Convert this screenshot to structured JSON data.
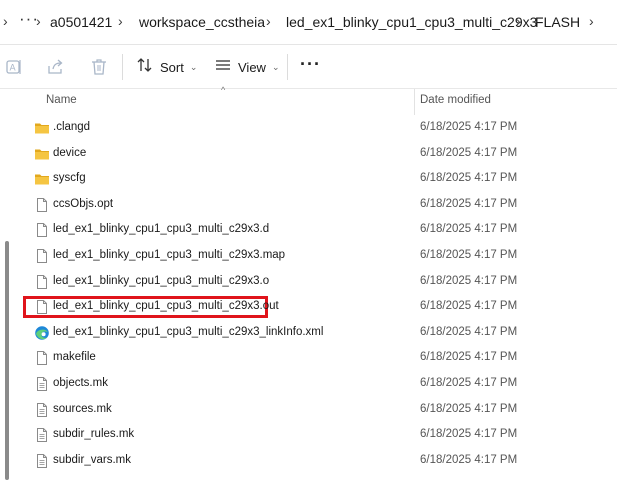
{
  "breadcrumb": {
    "more_label": "···",
    "items": [
      {
        "label": "a0501421"
      },
      {
        "label": "workspace_ccstheia"
      },
      {
        "label": "led_ex1_blinky_cpu1_cpu3_multi_c29x3"
      },
      {
        "label": "FLASH"
      }
    ]
  },
  "toolbar": {
    "sort_label": "Sort",
    "view_label": "View",
    "more_label": "···"
  },
  "columns": {
    "name": "Name",
    "date_modified": "Date modified"
  },
  "files": [
    {
      "name": ".clangd",
      "date": "6/18/2025 4:17 PM",
      "icon": "folder-icon"
    },
    {
      "name": "device",
      "date": "6/18/2025 4:17 PM",
      "icon": "folder-icon"
    },
    {
      "name": "syscfg",
      "date": "6/18/2025 4:17 PM",
      "icon": "folder-icon"
    },
    {
      "name": "ccsObjs.opt",
      "date": "6/18/2025 4:17 PM",
      "icon": "file-icon"
    },
    {
      "name": "led_ex1_blinky_cpu1_cpu3_multi_c29x3.d",
      "date": "6/18/2025 4:17 PM",
      "icon": "file-icon"
    },
    {
      "name": "led_ex1_blinky_cpu1_cpu3_multi_c29x3.map",
      "date": "6/18/2025 4:17 PM",
      "icon": "file-icon"
    },
    {
      "name": "led_ex1_blinky_cpu1_cpu3_multi_c29x3.o",
      "date": "6/18/2025 4:17 PM",
      "icon": "file-icon"
    },
    {
      "name": "led_ex1_blinky_cpu1_cpu3_multi_c29x3.out",
      "date": "6/18/2025 4:17 PM",
      "icon": "file-icon",
      "highlighted": true
    },
    {
      "name": "led_ex1_blinky_cpu1_cpu3_multi_c29x3_linkInfo.xml",
      "date": "6/18/2025 4:17 PM",
      "icon": "edge-icon"
    },
    {
      "name": "makefile",
      "date": "6/18/2025 4:17 PM",
      "icon": "file-icon"
    },
    {
      "name": "objects.mk",
      "date": "6/18/2025 4:17 PM",
      "icon": "text-file-icon"
    },
    {
      "name": "sources.mk",
      "date": "6/18/2025 4:17 PM",
      "icon": "text-file-icon"
    },
    {
      "name": "subdir_rules.mk",
      "date": "6/18/2025 4:17 PM",
      "icon": "text-file-icon"
    },
    {
      "name": "subdir_vars.mk",
      "date": "6/18/2025 4:17 PM",
      "icon": "text-file-icon"
    }
  ],
  "colors": {
    "highlight": "#e0141b",
    "folder": "#f5c542",
    "folder_dark": "#e2a81e"
  }
}
